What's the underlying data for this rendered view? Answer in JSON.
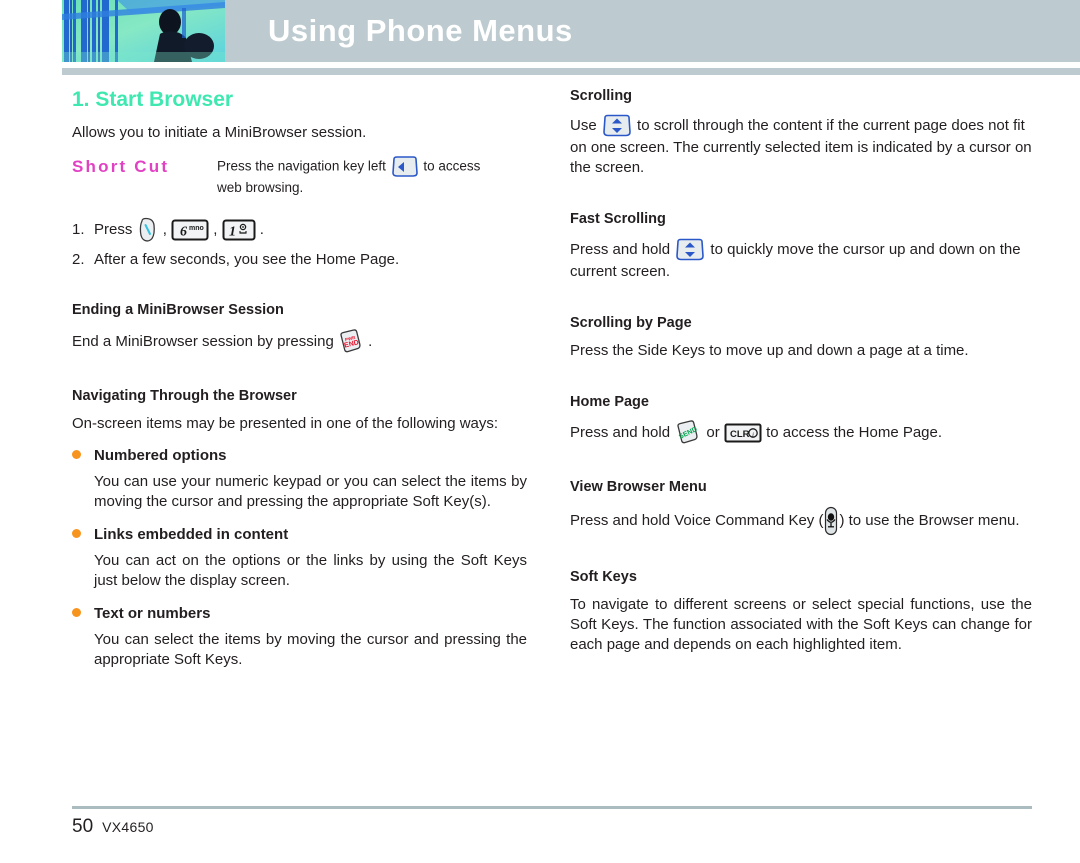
{
  "header": {
    "title": "Using Phone Menus",
    "bar_color": "#bdcbd0",
    "title_color": "#ffffff"
  },
  "colors": {
    "section_title": "#3ee8b0",
    "shortcut_label": "#e142c4",
    "bullet": "#f7941e",
    "body_text": "#231f20",
    "end_key_text": "#e8112d",
    "send_key_text": "#00a94f",
    "nav_key_blue": "#2b58c8"
  },
  "left_column": {
    "section_title": "1. Start Browser",
    "intro": "Allows you to initiate a MiniBrowser session.",
    "shortcut": {
      "label": "Short Cut",
      "text_before": "Press the navigation key left",
      "text_after": "to access",
      "text_line2": "web browsing."
    },
    "steps": [
      {
        "num": "1.",
        "prefix": "Press",
        "keys": [
          "menu-key",
          "6mno-key",
          "1-key"
        ],
        "suffix": "."
      },
      {
        "num": "2.",
        "text": "After a few seconds, you see the Home Page."
      }
    ],
    "ending_session": {
      "heading": "Ending a MiniBrowser Session",
      "text_before": "End a MiniBrowser session by pressing",
      "text_after": "."
    },
    "navigating": {
      "heading": "Navigating Through the Browser",
      "text": "On-screen items may be presented in one of the following ways:"
    },
    "bullets": [
      {
        "label": "Numbered options",
        "text": "You can use your numeric keypad or you can select the items by moving the cursor and pressing the appropriate Soft Key(s)."
      },
      {
        "label": "Links embedded in content",
        "text": "You can act on the options or the links by using the Soft Keys just below the display screen."
      },
      {
        "label": "Text or numbers",
        "text": "You can select the items by moving the cursor and pressing the appropriate Soft Keys."
      }
    ]
  },
  "right_column": {
    "scrolling": {
      "heading": "Scrolling",
      "text_before": "Use",
      "text_after": "to scroll through the content if the current page does not fit on one screen. The currently selected item is indicated by a cursor on the screen."
    },
    "fast_scrolling": {
      "heading": "Fast Scrolling",
      "text_before": "Press and hold",
      "text_after": "to quickly move the cursor up and down on the current screen."
    },
    "scrolling_by_page": {
      "heading": "Scrolling by Page",
      "text": "Press the Side Keys to move up and down a page at a time."
    },
    "home_page": {
      "heading": "Home Page",
      "text_before": "Press and hold",
      "text_middle": "or",
      "text_after": "to access the Home Page."
    },
    "view_browser_menu": {
      "heading": "View Browser Menu",
      "text_before": "Press and hold Voice Command Key (",
      "text_after": ") to use the Browser menu."
    },
    "soft_keys": {
      "heading": "Soft Keys",
      "text": "To navigate to different screens or select special functions, use the Soft Keys. The function associated with the Soft Keys can change for each page and depends on each highlighted item."
    }
  },
  "key_labels": {
    "six_key": "6",
    "six_key_letters": "mno",
    "one_key": "1",
    "end_key_top": "PWR",
    "end_key_bottom": "END",
    "send_key": "SEND",
    "clr_key": "CLR"
  },
  "footer": {
    "page_number": "50",
    "model": "VX4650"
  }
}
